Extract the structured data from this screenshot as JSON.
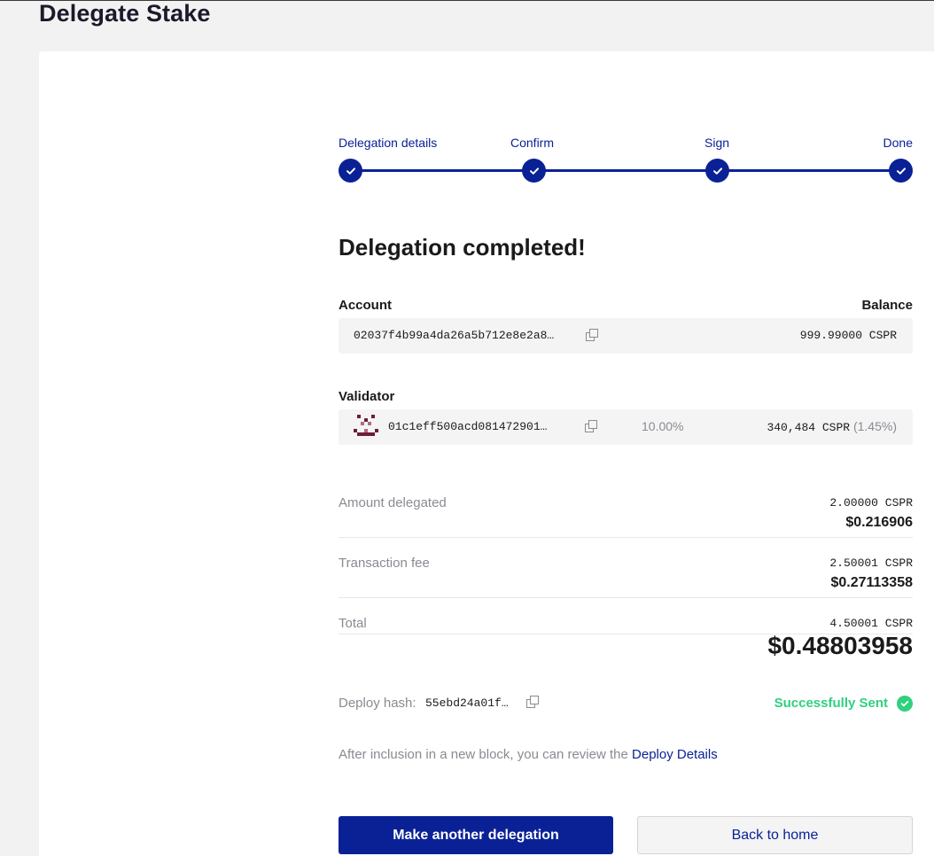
{
  "page": {
    "title": "Delegate Stake"
  },
  "stepper": {
    "steps": [
      {
        "label": "Delegation details"
      },
      {
        "label": "Confirm"
      },
      {
        "label": "Sign"
      },
      {
        "label": "Done"
      }
    ]
  },
  "status": {
    "heading": "Delegation completed!"
  },
  "account": {
    "label": "Account",
    "balance_label": "Balance",
    "key": "02037f4b99a4da26a5b712e8e2a8…",
    "balance": "999.99000 CSPR"
  },
  "validator": {
    "label": "Validator",
    "key": "01c1eff500acd081472901…",
    "commission": "10.00%",
    "stake": "340,484 CSPR",
    "share": "(1.45%)"
  },
  "summary": {
    "amount": {
      "label": "Amount delegated",
      "cspr": "2.00000 CSPR",
      "usd": "$0.216906"
    },
    "fee": {
      "label": "Transaction fee",
      "cspr": "2.50001 CSPR",
      "usd": "$0.27113358"
    },
    "total": {
      "label": "Total",
      "cspr": "4.50001 CSPR",
      "usd": "$0.48803958"
    }
  },
  "deploy": {
    "label": "Deploy hash:",
    "hash": "55ebd24a01f…",
    "status": "Successfully Sent",
    "info_text": "After inclusion in a new block, you can review the",
    "info_link": "Deploy Details"
  },
  "actions": {
    "primary": "Make another delegation",
    "secondary": "Back to home"
  },
  "colors": {
    "accent": "#0a2196",
    "success": "#2fd07e",
    "muted": "#8a8a92"
  }
}
